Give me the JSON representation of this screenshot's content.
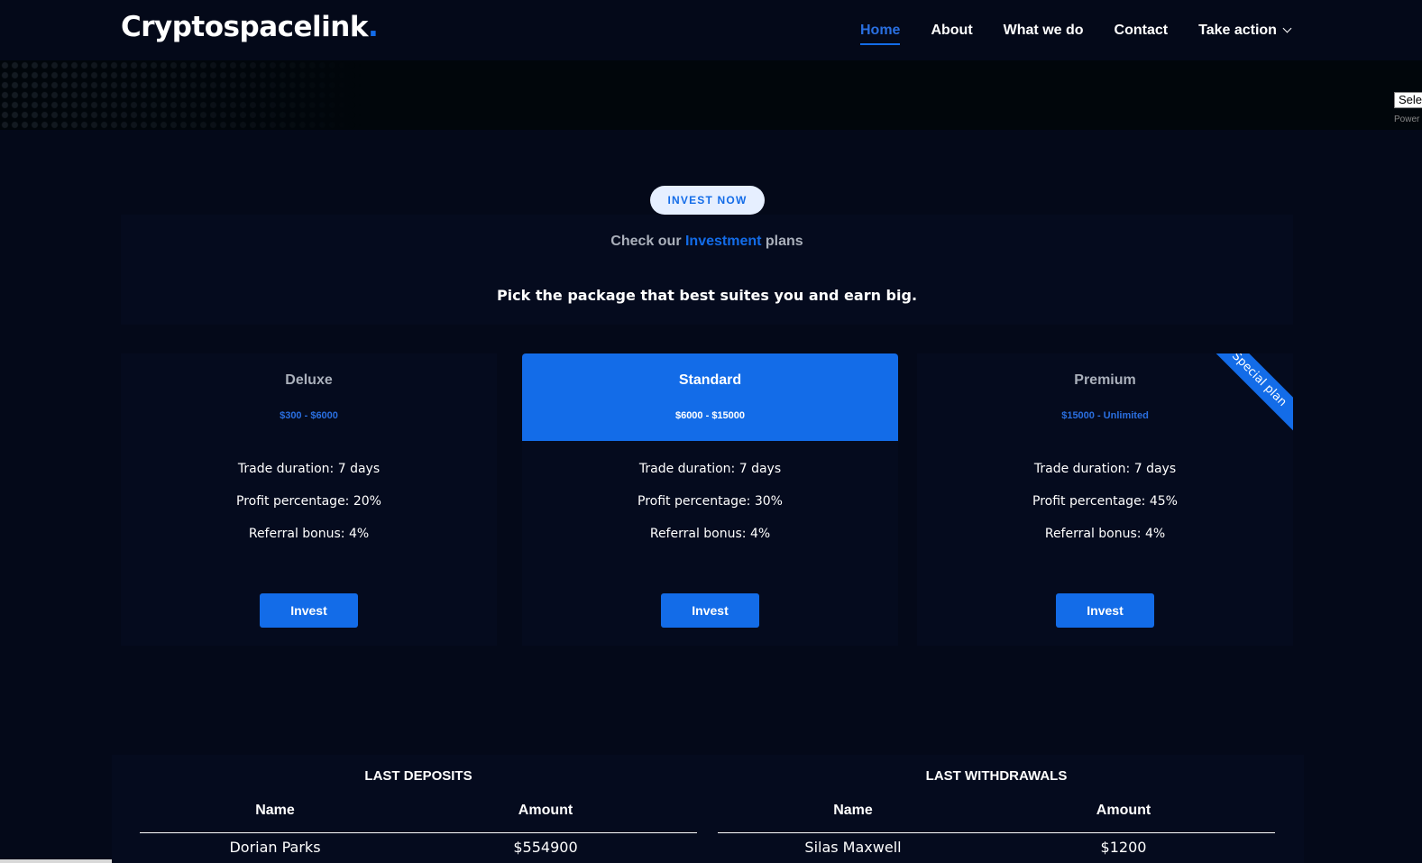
{
  "header": {
    "logo_text": "Cryptospacelink",
    "logo_dot": ".",
    "nav": [
      {
        "label": "Home",
        "active": true
      },
      {
        "label": "About"
      },
      {
        "label": "What we do"
      },
      {
        "label": "Contact"
      },
      {
        "label": "Take action",
        "has_dropdown": true
      }
    ]
  },
  "translate": {
    "select_text": "Sele",
    "powered_text": "Power"
  },
  "intro": {
    "pill_label": "INVEST NOW",
    "title_before": "Check our ",
    "title_highlight": "Investment",
    "title_after": " plans",
    "subtitle": "Pick the package that best suites you and earn big."
  },
  "plans": [
    {
      "name": "Deluxe",
      "range": "$300 - $6000",
      "duration": "Trade duration: 7 days",
      "profit": "Profit percentage: 20%",
      "referral": "Referral bonus: 4%",
      "button": "Invest"
    },
    {
      "name": "Standard",
      "range": "$6000 - $15000",
      "duration": "Trade duration: 7 days",
      "profit": "Profit percentage: 30%",
      "referral": "Referral bonus: 4%",
      "button": "Invest",
      "featured": true
    },
    {
      "name": "Premium",
      "range": "$15000 - Unlimited",
      "duration": "Trade duration: 7 days",
      "profit": "Profit percentage: 45%",
      "referral": "Referral bonus: 4%",
      "button": "Invest",
      "ribbon": "Special plan"
    }
  ],
  "transactions": {
    "deposits": {
      "title": "LAST DEPOSITS",
      "headers": [
        "Name",
        "Amount"
      ],
      "rows": [
        [
          "Dorian Parks",
          "$554900"
        ]
      ]
    },
    "withdrawals": {
      "title": "LAST WITHDRAWALS",
      "headers": [
        "Name",
        "Amount"
      ],
      "rows": [
        [
          "Silas Maxwell",
          "$1200"
        ]
      ]
    }
  },
  "colors": {
    "background": "#040919",
    "panel": "#050b1e",
    "accent": "#136ce8",
    "muted_text": "#aab0bb"
  }
}
